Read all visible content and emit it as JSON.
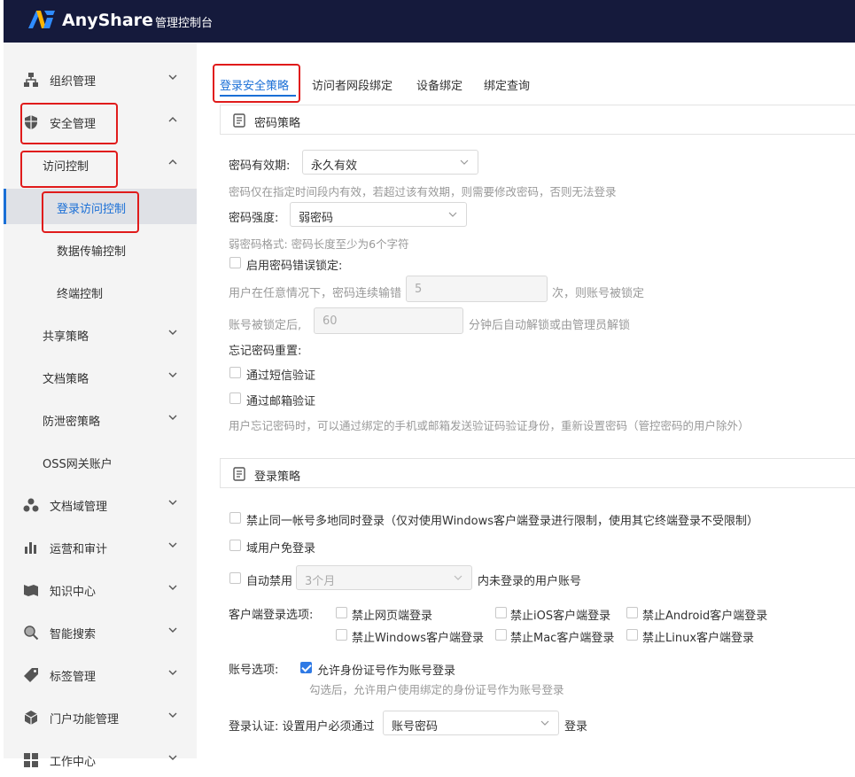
{
  "header": {
    "brand": "AnyShare",
    "console_title": "管理控制台"
  },
  "sidebar": {
    "items": [
      {
        "label": "组织管理",
        "icon": "org-chart-icon",
        "chevron": "down"
      },
      {
        "label": "安全管理",
        "icon": "shield-icon",
        "chevron": "up"
      },
      {
        "label": "访问控制",
        "chevron": "up"
      },
      {
        "label": "登录访问控制",
        "active": true
      },
      {
        "label": "数据传输控制"
      },
      {
        "label": "终端控制"
      },
      {
        "label": "共享策略",
        "chevron": "down"
      },
      {
        "label": "文档策略",
        "chevron": "down"
      },
      {
        "label": "防泄密策略",
        "chevron": "down"
      },
      {
        "label": "OSS网关账户"
      },
      {
        "label": "文档域管理",
        "icon": "cluster-icon",
        "chevron": "down"
      },
      {
        "label": "运营和审计",
        "icon": "bar-chart-icon",
        "chevron": "down"
      },
      {
        "label": "知识中心",
        "icon": "book-icon",
        "chevron": "down"
      },
      {
        "label": "智能搜索",
        "icon": "search-icon",
        "chevron": "down"
      },
      {
        "label": "标签管理",
        "icon": "tag-icon",
        "chevron": "down"
      },
      {
        "label": "门户功能管理",
        "icon": "cube-icon",
        "chevron": "down"
      },
      {
        "label": "工作中心",
        "icon": "grid-icon",
        "chevron": "down"
      }
    ]
  },
  "tabs": [
    "登录安全策略",
    "访问者网段绑定",
    "设备绑定",
    "绑定查询"
  ],
  "password_policy": {
    "section_title": "密码策略",
    "validity_label": "密码有效期:",
    "validity_value": "永久有效",
    "validity_hint": "密码仅在指定时间段内有效，若超过该有效期，则需要修改密码，否则无法登录",
    "strength_label": "密码强度:",
    "strength_value": "弱密码",
    "strength_hint": "弱密码格式: 密码长度至少为6个字符",
    "lockout_label": "启用密码错误锁定:",
    "lockout_text_before": "用户在任意情况下，密码连续输错",
    "lockout_attempts": "5",
    "lockout_text_after": "次，则账号被锁定",
    "locked_text_before": "账号被锁定后,",
    "locked_minutes": "60",
    "locked_text_after": "分钟后自动解锁或由管理员解锁",
    "reset_label": "忘记密码重置:",
    "sms_label": "通过短信验证",
    "email_label": "通过邮箱验证",
    "reset_hint": "用户忘记密码时，可以通过绑定的手机或邮箱发送验证码验证身份，重新设置密码（管控密码的用户除外）"
  },
  "login_policy": {
    "section_title": "登录策略",
    "single_login_label": "禁止同一帐号多地同时登录（仅对使用Windows客户端登录进行限制，使用其它终端登录不受限制）",
    "domain_free_label": "域用户免登录",
    "auto_disable_label": "自动禁用",
    "auto_disable_value": "3个月",
    "auto_disable_after": "内未登录的用户账号",
    "client_options_label": "客户端登录选项:",
    "client_options": [
      "禁止网页端登录",
      "禁止iOS客户端登录",
      "禁止Android客户端登录",
      "禁止Windows客户端登录",
      "禁止Mac客户端登录",
      "禁止Linux客户端登录"
    ],
    "account_options_label": "账号选项:",
    "id_login_label": "允许身份证号作为账号登录",
    "id_login_hint": "勾选后，允许用户使用绑定的身份证号作为账号登录",
    "auth_label": "登录认证: 设置用户必须通过",
    "auth_value": "账号密码",
    "auth_after": "登录"
  }
}
